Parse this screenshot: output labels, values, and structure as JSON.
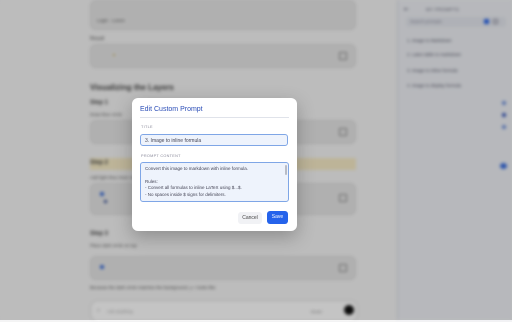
{
  "background": {
    "login_text": "Login · Lorem",
    "result_label": "Result",
    "section_title": "Visualizing the Layers",
    "steps": [
      {
        "title": "Step 1",
        "desc": "Draw blue circle"
      },
      {
        "title": "Step 2",
        "desc": "Add light blue inner circle"
      },
      {
        "title": "Step 3",
        "desc": "Place dark circle on top"
      }
    ],
    "footer_text": "Because the dark circle matches the background, y ≈ looks like",
    "chat_placeholder": "Ask anything",
    "chat_model": "Model"
  },
  "sidebar": {
    "title": "MY PROMPTS",
    "search_placeholder": "Search prompts",
    "items": [
      "1. Image to Markdown",
      "2. Latex table to markdown",
      "3. Image to inline formula",
      "4. Image to display formula"
    ]
  },
  "modal": {
    "title": "Edit Custom Prompt",
    "title_label": "TITLE",
    "title_value": "3. Image to inline formula",
    "content_label": "PROMPT CONTENT",
    "content_lines": [
      "Convert this image to markdown with inline formula.",
      "",
      "Rules:",
      "- Convert all formulas to inline LaTeX using $...$.",
      "- No spaces inside $ signs for delimiters."
    ],
    "cancel_label": "Cancel",
    "save_label": "Save"
  },
  "colors": {
    "accent": "#2563eb",
    "modal_title": "#2d4fb8",
    "highlight": "#f6ebc6"
  }
}
